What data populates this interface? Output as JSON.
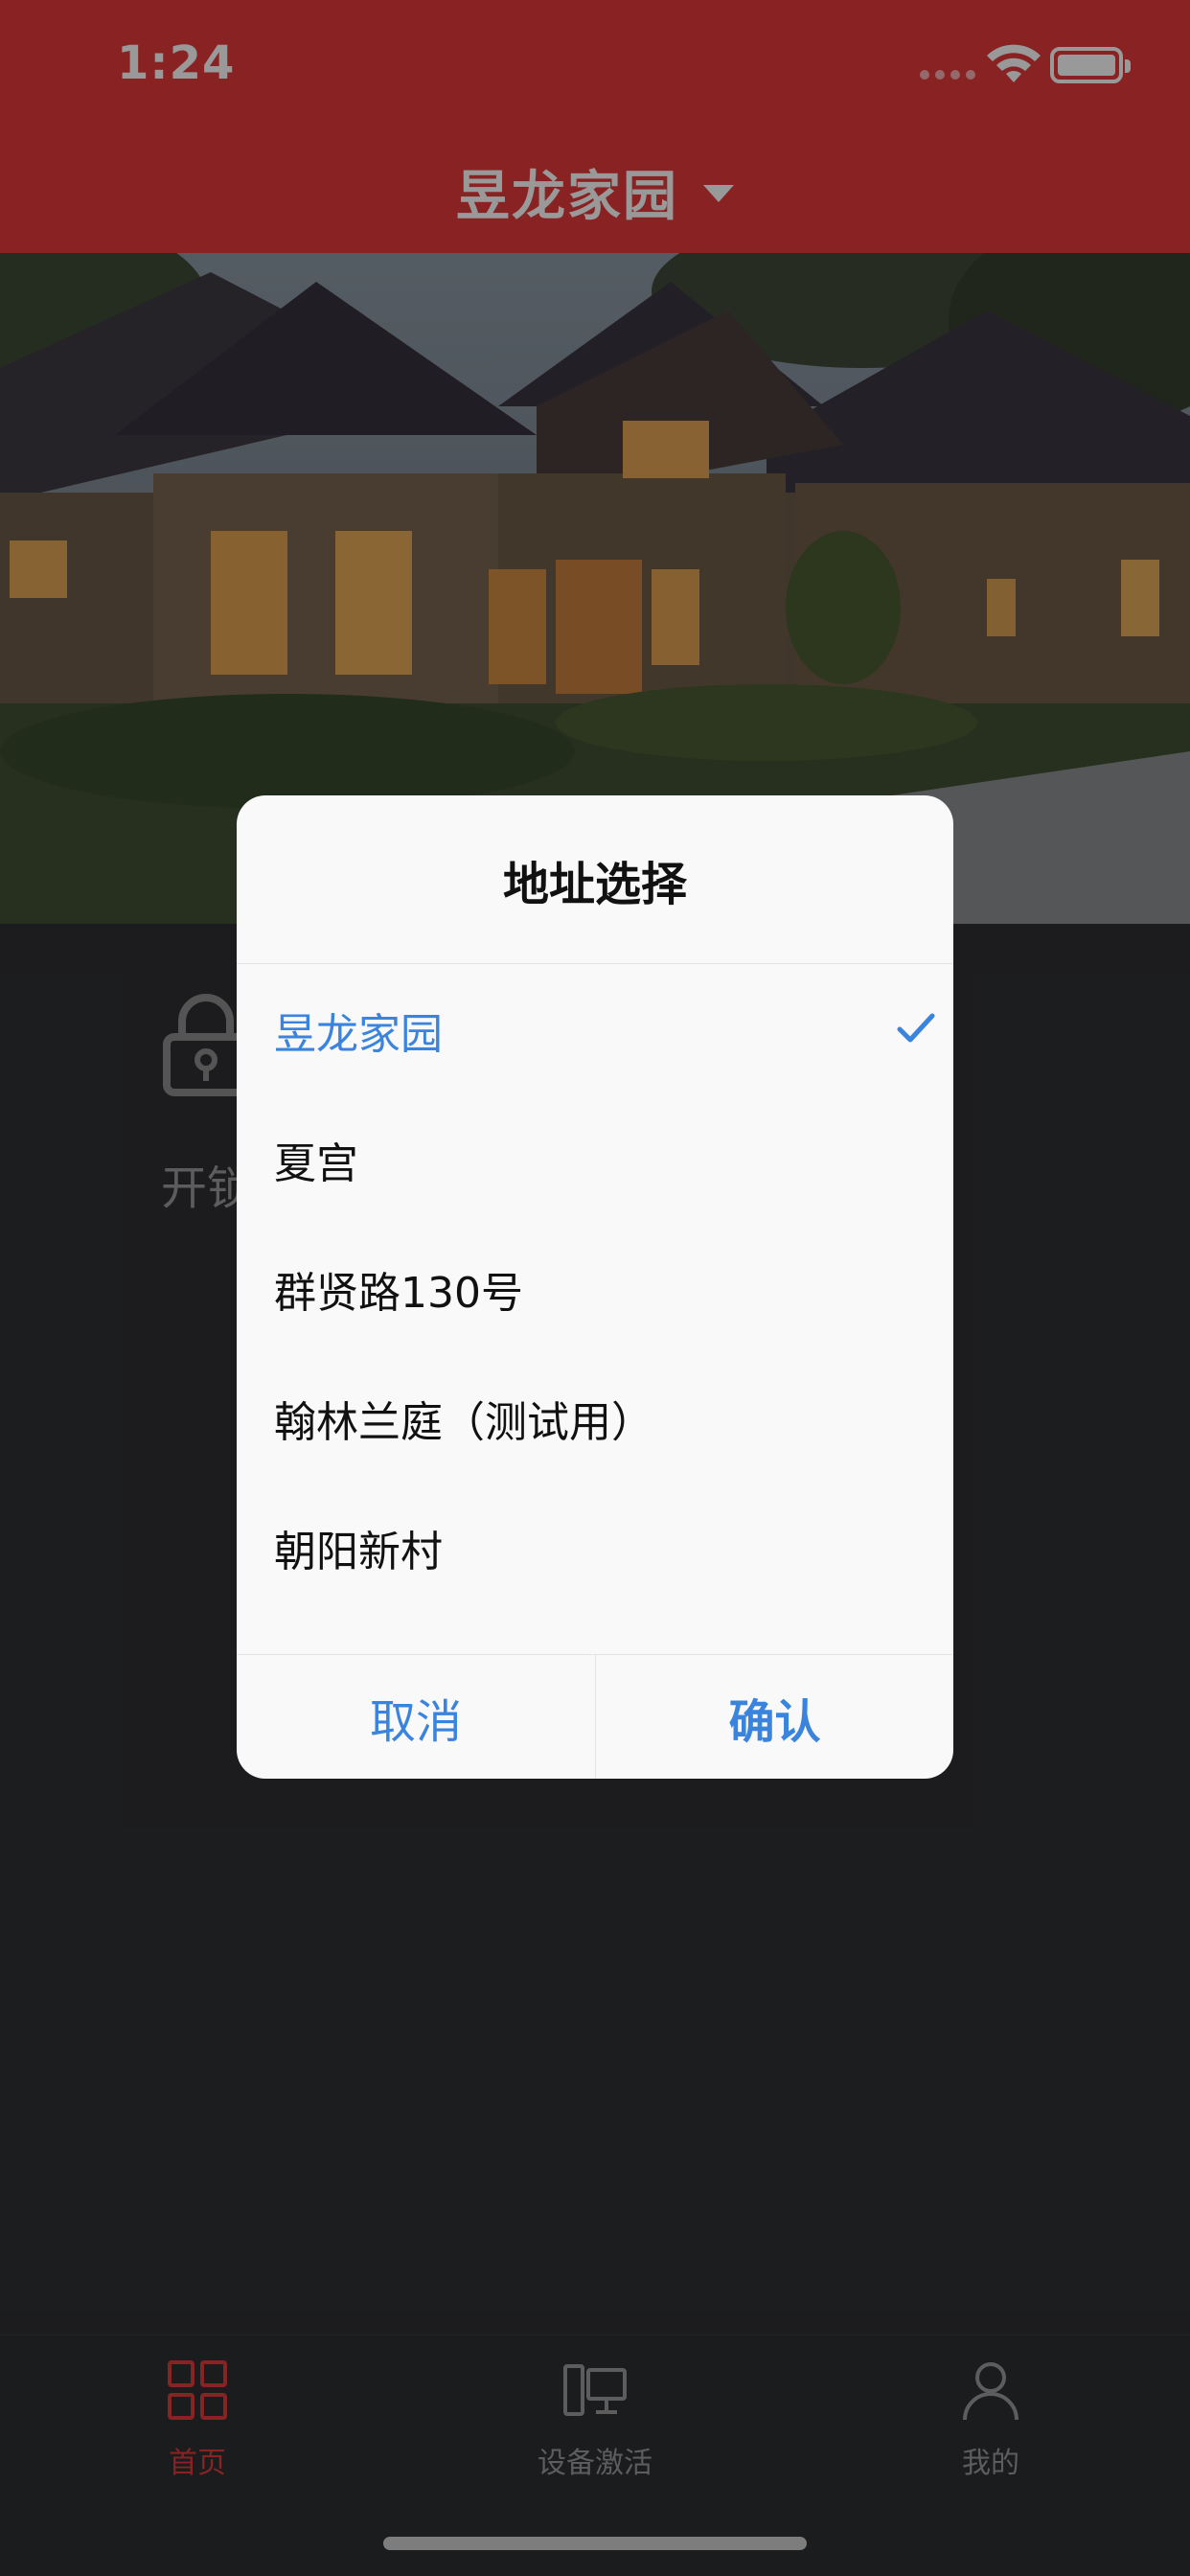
{
  "status_bar": {
    "time": "1:24"
  },
  "header": {
    "title": "昱龙家园"
  },
  "main": {
    "unlock_label": "开锁"
  },
  "dialog": {
    "title": "地址选择",
    "options": [
      {
        "label": "昱龙家园",
        "selected": true
      },
      {
        "label": "夏宫",
        "selected": false
      },
      {
        "label": "群贤路130号",
        "selected": false
      },
      {
        "label": "翰林兰庭（测试用）",
        "selected": false
      },
      {
        "label": "朝阳新村",
        "selected": false
      }
    ],
    "cancel_label": "取消",
    "confirm_label": "确认"
  },
  "tabbar": {
    "items": [
      {
        "label": "首页",
        "icon": "grid-icon",
        "active": true
      },
      {
        "label": "设备激活",
        "icon": "devices-icon",
        "active": false
      },
      {
        "label": "我的",
        "icon": "person-icon",
        "active": false
      }
    ]
  },
  "colors": {
    "header": "#e53b3b",
    "accent": "#3b84de",
    "active_tab": "#e03b3b"
  }
}
